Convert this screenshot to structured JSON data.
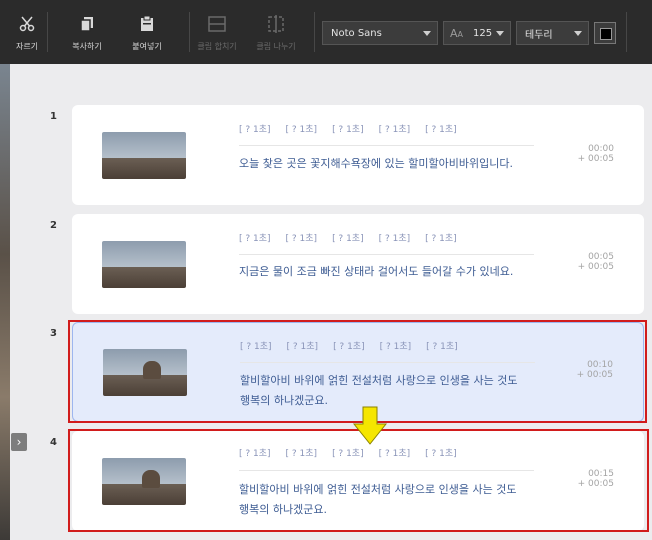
{
  "toolbar": {
    "cut": "자르기",
    "copy": "복사하기",
    "paste": "붙여넣기",
    "merge": "클립 합치기",
    "split": "클립 나누기",
    "font": "Noto Sans",
    "font_size": "125",
    "border": "테두리",
    "text_color": "#000000"
  },
  "clips": [
    {
      "number": "1",
      "tokens": [
        "[ ? 1초]",
        "[ ? 1초]",
        "[ ? 1초]",
        "[ ? 1초]",
        "[ ? 1초]"
      ],
      "text": "오늘 찾은 곳은 꽃지해수욕장에 있는 할미할아비바위입니다.",
      "start": "00:00",
      "duration": "+ 00:05"
    },
    {
      "number": "2",
      "tokens": [
        "[ ? 1초]",
        "[ ? 1초]",
        "[ ? 1초]",
        "[ ? 1초]",
        "[ ? 1초]"
      ],
      "text": "지금은 물이 조금 빠진 상태라 걸어서도 들어갈 수가 있네요.",
      "start": "00:05",
      "duration": "+ 00:05"
    },
    {
      "number": "3",
      "tokens": [
        "[ ? 1초]",
        "[ ? 1초]",
        "[ ? 1초]",
        "[ ? 1초]",
        "[ ? 1초]"
      ],
      "text": "할비할아비 바위에 얽힌 전설처럼 사랑으로 인생을 사는 것도 행복의 하나겠군요.",
      "start": "00:10",
      "duration": "+ 00:05"
    },
    {
      "number": "4",
      "tokens": [
        "[ ? 1초]",
        "[ ? 1초]",
        "[ ? 1초]",
        "[ ? 1초]",
        "[ ? 1초]"
      ],
      "text": "할비할아비 바위에 얽힌 전설처럼 사랑으로 인생을 사는 것도 행복의 하나겠군요.",
      "start": "00:15",
      "duration": "+ 00:05"
    }
  ],
  "colors": {
    "highlight": "#d11c1c",
    "arrow": "#f5e600",
    "selected_bg": "#e4ebfb"
  }
}
